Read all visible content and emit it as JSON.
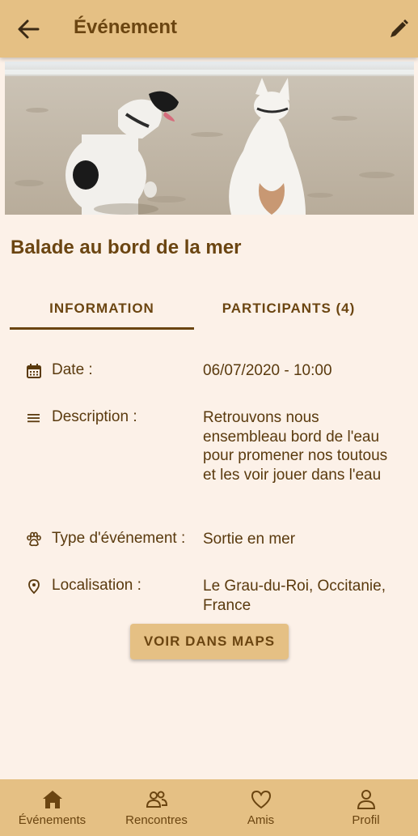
{
  "appbar": {
    "title": "Événement",
    "back_icon": "arrow-left-icon",
    "edit_icon": "pencil-icon"
  },
  "hero": {
    "image": "photo of two dogs sitting on a sandy beach facing the sea"
  },
  "event": {
    "title": "Balade au bord de la mer"
  },
  "tabs": [
    {
      "label": "INFORMATION",
      "selected": true
    },
    {
      "label": "PARTICIPANTS (4)",
      "selected": false
    }
  ],
  "details": [
    {
      "icon": "calendar-icon",
      "label": "Date :",
      "value": "06/07/2020 - 10:00"
    },
    {
      "icon": "menu-lines-icon",
      "label": "Description :",
      "value": "Retrouvons nous ensembleau bord de l'eau pour promener nos toutous et les voir jouer dans l'eau"
    },
    {
      "icon": "paw-icon",
      "label": "Type d'événement :",
      "value": "Sortie en mer"
    },
    {
      "icon": "location-pin-icon",
      "label": "Localisation :",
      "value": "Le Grau-du-Roi, Occitanie, France"
    }
  ],
  "maps_button": {
    "label": "VOIR DANS MAPS"
  },
  "bottom_nav": [
    {
      "icon": "home-icon",
      "label": "Événements"
    },
    {
      "icon": "people-icon",
      "label": "Rencontres"
    },
    {
      "icon": "heart-icon",
      "label": "Amis"
    },
    {
      "icon": "person-icon",
      "label": "Profil"
    }
  ],
  "colors": {
    "background": "#fcf1e8",
    "accent": "#e5c084",
    "text": "#6b4511"
  }
}
